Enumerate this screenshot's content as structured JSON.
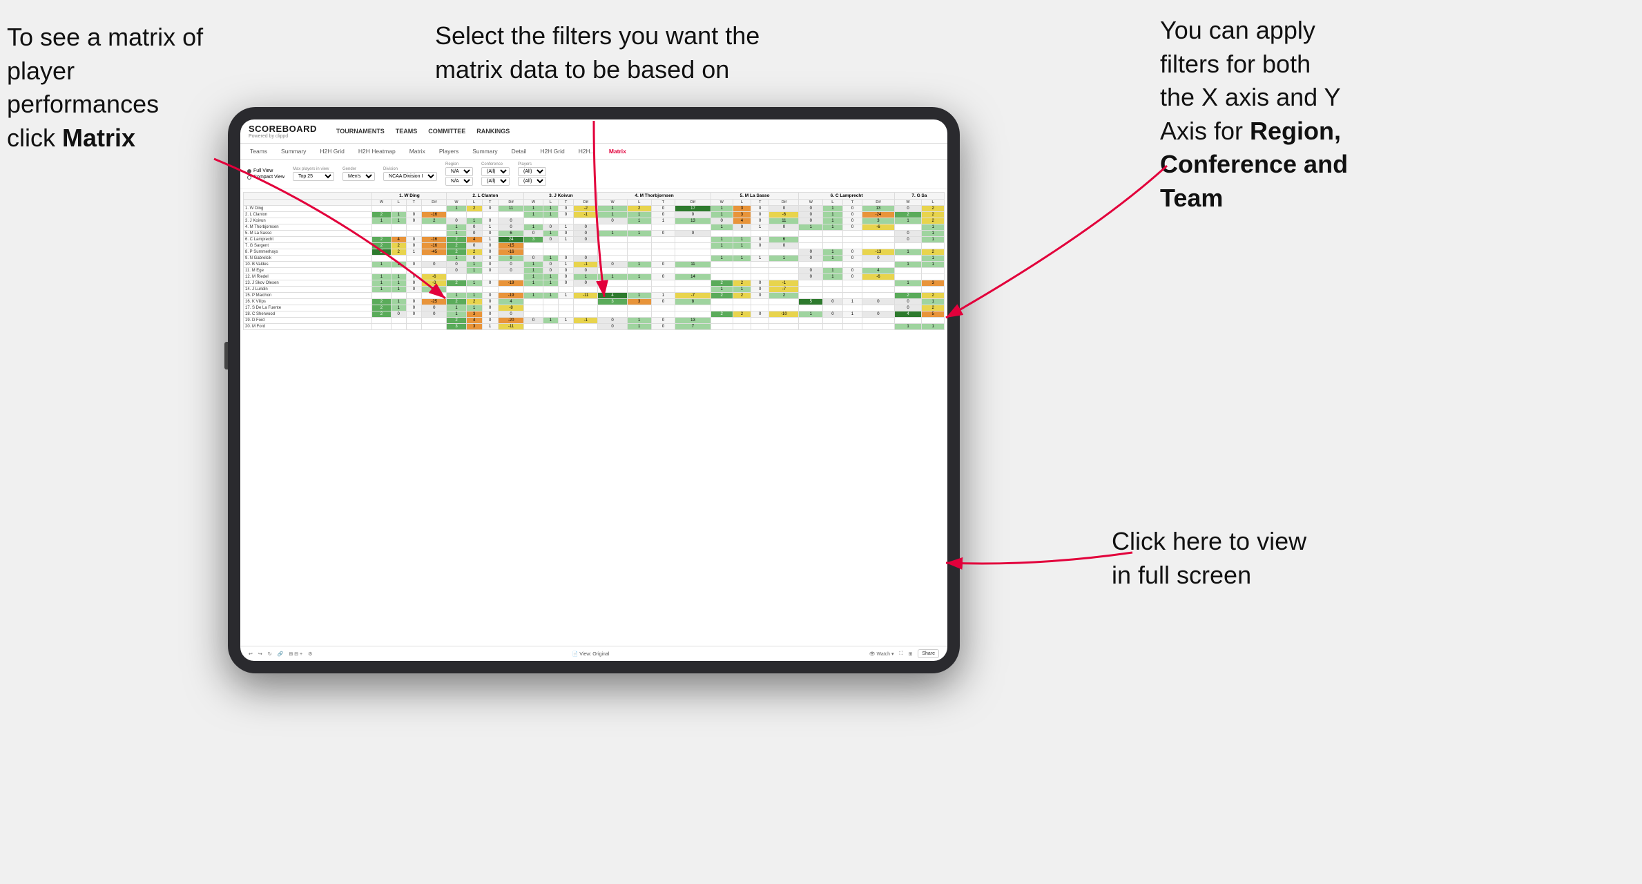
{
  "annotations": {
    "top_left": {
      "line1": "To see a matrix of",
      "line2": "player performances",
      "line3_prefix": "click ",
      "line3_bold": "Matrix"
    },
    "top_center": {
      "line1": "Select the filters you want the",
      "line2": "matrix data to be based on"
    },
    "top_right": {
      "line1": "You  can apply",
      "line2": "filters for both",
      "line3": "the X axis and Y",
      "line4_prefix": "Axis for ",
      "line4_bold": "Region,",
      "line5_bold": "Conference and",
      "line6_bold": "Team"
    },
    "bottom_right": {
      "line1": "Click here to view",
      "line2": "in full screen"
    }
  },
  "app": {
    "logo": "SCOREBOARD",
    "logo_sub": "Powered by clippd",
    "nav": [
      "TOURNAMENTS",
      "TEAMS",
      "COMMITTEE",
      "RANKINGS"
    ],
    "sub_nav": [
      "Teams",
      "Summary",
      "H2H Grid",
      "H2H Heatmap",
      "Matrix",
      "Players",
      "Summary",
      "Detail",
      "H2H Grid",
      "H2H...",
      "Matrix"
    ],
    "active_tab": "Matrix",
    "views": [
      "Full View",
      "Compact View"
    ],
    "filters": {
      "max_players": {
        "label": "Max players in view",
        "value": "Top 25"
      },
      "gender": {
        "label": "Gender",
        "value": "Men's"
      },
      "division": {
        "label": "Division",
        "value": "NCAA Division I"
      },
      "region": {
        "label": "Region",
        "values": [
          "N/A",
          "N/A"
        ]
      },
      "conference": {
        "label": "Conference",
        "values": [
          "(All)",
          "(All)"
        ]
      },
      "players": {
        "label": "Players",
        "values": [
          "(All)",
          "(All)"
        ]
      }
    },
    "col_headers": [
      "1. W Ding",
      "2. L Clanton",
      "3. J Koivun",
      "4. M Thorbjornsen",
      "5. M La Sasso",
      "6. C Lamprecht",
      "7. G Sa"
    ],
    "sub_cols": [
      "W",
      "L",
      "T",
      "Dif"
    ],
    "rows": [
      {
        "name": "1. W Ding",
        "cells": [
          [
            "",
            "",
            "",
            ""
          ],
          [
            "1",
            "2",
            "0",
            "11"
          ],
          [
            "1",
            "1",
            "0",
            "-2"
          ],
          [
            "1",
            "2",
            "0",
            "17"
          ],
          [
            "1",
            "3",
            "0",
            "0"
          ],
          [
            "0",
            "1",
            "0",
            "13"
          ],
          [
            "0",
            "2"
          ]
        ]
      },
      {
        "name": "2. L Clanton",
        "cells": [
          [
            "2",
            "1",
            "0",
            "-16"
          ],
          [
            "",
            "",
            "",
            ""
          ],
          [
            "1",
            "1",
            "0",
            "-1"
          ],
          [
            "1",
            "1",
            "0",
            "0"
          ],
          [
            "1",
            "3",
            "0",
            "-6"
          ],
          [
            "0",
            "1",
            "0",
            "-24"
          ],
          [
            "2",
            "2"
          ]
        ]
      },
      {
        "name": "3. J Koivun",
        "cells": [
          [
            "1",
            "1",
            "0",
            "2"
          ],
          [
            "0",
            "1",
            "0",
            "0"
          ],
          [
            "",
            "",
            "",
            ""
          ],
          [
            "0",
            "1",
            "1",
            "13"
          ],
          [
            "0",
            "4",
            "0",
            "11"
          ],
          [
            "0",
            "1",
            "0",
            "3"
          ],
          [
            "1",
            "2"
          ]
        ]
      },
      {
        "name": "4. M Thorbjornsen",
        "cells": [
          [
            "",
            "",
            "",
            ""
          ],
          [
            "1",
            "0",
            "1",
            "0"
          ],
          [
            "1",
            "0",
            "1",
            "0"
          ],
          [
            "",
            "",
            "",
            ""
          ],
          [
            "1",
            "0",
            "1",
            "0"
          ],
          [
            "1",
            "1",
            "0",
            "-6"
          ],
          [
            "",
            "1"
          ]
        ]
      },
      {
        "name": "5. M La Sasso",
        "cells": [
          [
            "",
            "",
            "",
            ""
          ],
          [
            "1",
            "0",
            "0",
            "6"
          ],
          [
            "0",
            "1",
            "0",
            "0"
          ],
          [
            "1",
            "1",
            "0",
            "0"
          ],
          [
            "",
            "",
            "",
            ""
          ],
          [
            "",
            "",
            "",
            ""
          ],
          [
            "0",
            "1"
          ]
        ]
      },
      {
        "name": "6. C Lamprecht",
        "cells": [
          [
            "2",
            "4",
            "0",
            "-16"
          ],
          [
            "2",
            "4",
            "1",
            "24"
          ],
          [
            "3",
            "0",
            "1",
            "0"
          ],
          [
            "",
            "",
            "",
            ""
          ],
          [
            "1",
            "1",
            "0",
            "6"
          ],
          [
            "",
            "",
            "",
            ""
          ],
          [
            "0",
            "1"
          ]
        ]
      },
      {
        "name": "7. G Sargent",
        "cells": [
          [
            "2",
            "2",
            "0",
            "-16"
          ],
          [
            "2",
            "0",
            "0",
            "-15"
          ],
          [
            "",
            "",
            "",
            ""
          ],
          [
            "",
            "",
            "",
            ""
          ],
          [
            "1",
            "1",
            "0",
            "0"
          ],
          [
            "",
            "",
            "",
            ""
          ],
          [
            "",
            ""
          ]
        ]
      },
      {
        "name": "8. P Summerhays",
        "cells": [
          [
            "5",
            "2",
            "1",
            "-45"
          ],
          [
            "2",
            "2",
            "0",
            "-16"
          ],
          [
            "",
            "",
            "",
            ""
          ],
          [
            "",
            "",
            "",
            ""
          ],
          [
            "",
            "",
            "",
            ""
          ],
          [
            "0",
            "1",
            "0",
            "-13"
          ],
          [
            "1",
            "2"
          ]
        ]
      },
      {
        "name": "9. N Gabrelcik",
        "cells": [
          [
            "",
            "",
            "",
            ""
          ],
          [
            "1",
            "0",
            "0",
            "9"
          ],
          [
            "0",
            "1",
            "0",
            "0"
          ],
          [
            "",
            "",
            "",
            ""
          ],
          [
            "1",
            "1",
            "1",
            "1"
          ],
          [
            "0",
            "1",
            "0",
            "0"
          ],
          [
            "",
            "1"
          ]
        ]
      },
      {
        "name": "10. B Valdes",
        "cells": [
          [
            "1",
            "1",
            "0",
            "0"
          ],
          [
            "0",
            "1",
            "0",
            "0"
          ],
          [
            "1",
            "0",
            "1",
            "-1"
          ],
          [
            "0",
            "1",
            "0",
            "11"
          ],
          [
            "",
            "",
            "",
            ""
          ],
          [
            "",
            "",
            "",
            ""
          ],
          [
            "1",
            "1"
          ]
        ]
      },
      {
        "name": "11. M Ege",
        "cells": [
          [
            "",
            "",
            "",
            ""
          ],
          [
            "0",
            "1",
            "0",
            "0"
          ],
          [
            "1",
            "0",
            "0",
            "0"
          ],
          [
            "",
            "",
            "",
            ""
          ],
          [
            "",
            "",
            "",
            ""
          ],
          [
            "0",
            "1",
            "0",
            "4"
          ],
          [
            "",
            ""
          ]
        ]
      },
      {
        "name": "12. M Riedel",
        "cells": [
          [
            "1",
            "1",
            "0",
            "-6"
          ],
          [
            "",
            "",
            "",
            ""
          ],
          [
            "1",
            "1",
            "0",
            "1"
          ],
          [
            "1",
            "1",
            "0",
            "14"
          ],
          [
            "",
            "",
            "",
            ""
          ],
          [
            "0",
            "1",
            "0",
            "-6"
          ],
          [
            "",
            ""
          ]
        ]
      },
      {
        "name": "13. J Skov Olesen",
        "cells": [
          [
            "1",
            "1",
            "0",
            "-3"
          ],
          [
            "2",
            "1",
            "0",
            "-19"
          ],
          [
            "1",
            "1",
            "0",
            "0"
          ],
          [
            "",
            "",
            "",
            ""
          ],
          [
            "2",
            "2",
            "0",
            "-1"
          ],
          [
            "",
            "",
            "",
            ""
          ],
          [
            "1",
            "3"
          ]
        ]
      },
      {
        "name": "14. J Lundin",
        "cells": [
          [
            "1",
            "1",
            "0",
            "10"
          ],
          [
            "",
            "",
            "",
            ""
          ],
          [
            "",
            "",
            "",
            ""
          ],
          [
            "",
            "",
            "",
            ""
          ],
          [
            "1",
            "1",
            "0",
            "-7"
          ],
          [
            "",
            "",
            "",
            ""
          ],
          [
            "",
            ""
          ]
        ]
      },
      {
        "name": "15. P Maichon",
        "cells": [
          [
            "",
            "",
            "",
            ""
          ],
          [
            "1",
            "1",
            "0",
            "-19"
          ],
          [
            "1",
            "1",
            "1",
            "-11"
          ],
          [
            "4",
            "1",
            "1",
            "-7"
          ],
          [
            "2",
            "2",
            "0",
            "2"
          ],
          [
            "",
            "",
            "",
            ""
          ],
          [
            "2",
            "2"
          ]
        ]
      },
      {
        "name": "16. K Vilips",
        "cells": [
          [
            "2",
            "1",
            "0",
            "-25"
          ],
          [
            "2",
            "2",
            "0",
            "4"
          ],
          [
            "",
            "",
            "",
            ""
          ],
          [
            "3",
            "3",
            "0",
            "8"
          ],
          [
            "",
            "",
            "",
            ""
          ],
          [
            "5",
            "0",
            "1",
            "0"
          ],
          [
            "0",
            "1"
          ]
        ]
      },
      {
        "name": "17. S De La Fuente",
        "cells": [
          [
            "2",
            "1",
            "0",
            "0"
          ],
          [
            "1",
            "1",
            "0",
            "-8"
          ],
          [
            "",
            "",
            "",
            ""
          ],
          [
            "",
            "",
            "",
            ""
          ],
          [
            "",
            "",
            "",
            ""
          ],
          [
            "",
            "",
            "",
            ""
          ],
          [
            "0",
            "2"
          ]
        ]
      },
      {
        "name": "18. C Sherwood",
        "cells": [
          [
            "2",
            "0",
            "0",
            "0"
          ],
          [
            "1",
            "3",
            "0",
            "0"
          ],
          [
            "",
            "",
            "",
            ""
          ],
          [
            "",
            "",
            "",
            ""
          ],
          [
            "2",
            "2",
            "0",
            "-10"
          ],
          [
            "1",
            "0",
            "1",
            "0"
          ],
          [
            "4",
            "5"
          ]
        ]
      },
      {
        "name": "19. D Ford",
        "cells": [
          [
            "",
            "",
            "",
            ""
          ],
          [
            "2",
            "4",
            "0",
            "-20"
          ],
          [
            "0",
            "1",
            "1",
            "-1"
          ],
          [
            "0",
            "1",
            "0",
            "13"
          ],
          [
            "",
            "",
            "",
            ""
          ],
          [
            "",
            "",
            "",
            ""
          ],
          [
            "",
            ""
          ]
        ]
      },
      {
        "name": "20. M Ford",
        "cells": [
          [
            "",
            "",
            "",
            ""
          ],
          [
            "3",
            "3",
            "1",
            "-11"
          ],
          [
            "",
            "",
            "",
            ""
          ],
          [
            "0",
            "1",
            "0",
            "7"
          ],
          [
            "",
            "",
            "",
            ""
          ],
          [
            "",
            "",
            "",
            ""
          ],
          [
            "1",
            "1"
          ]
        ]
      }
    ],
    "footer": {
      "view_label": "View: Original",
      "watch_label": "Watch",
      "share_label": "Share"
    }
  },
  "colors": {
    "accent": "#e2003b",
    "arrow": "#e2003b"
  }
}
